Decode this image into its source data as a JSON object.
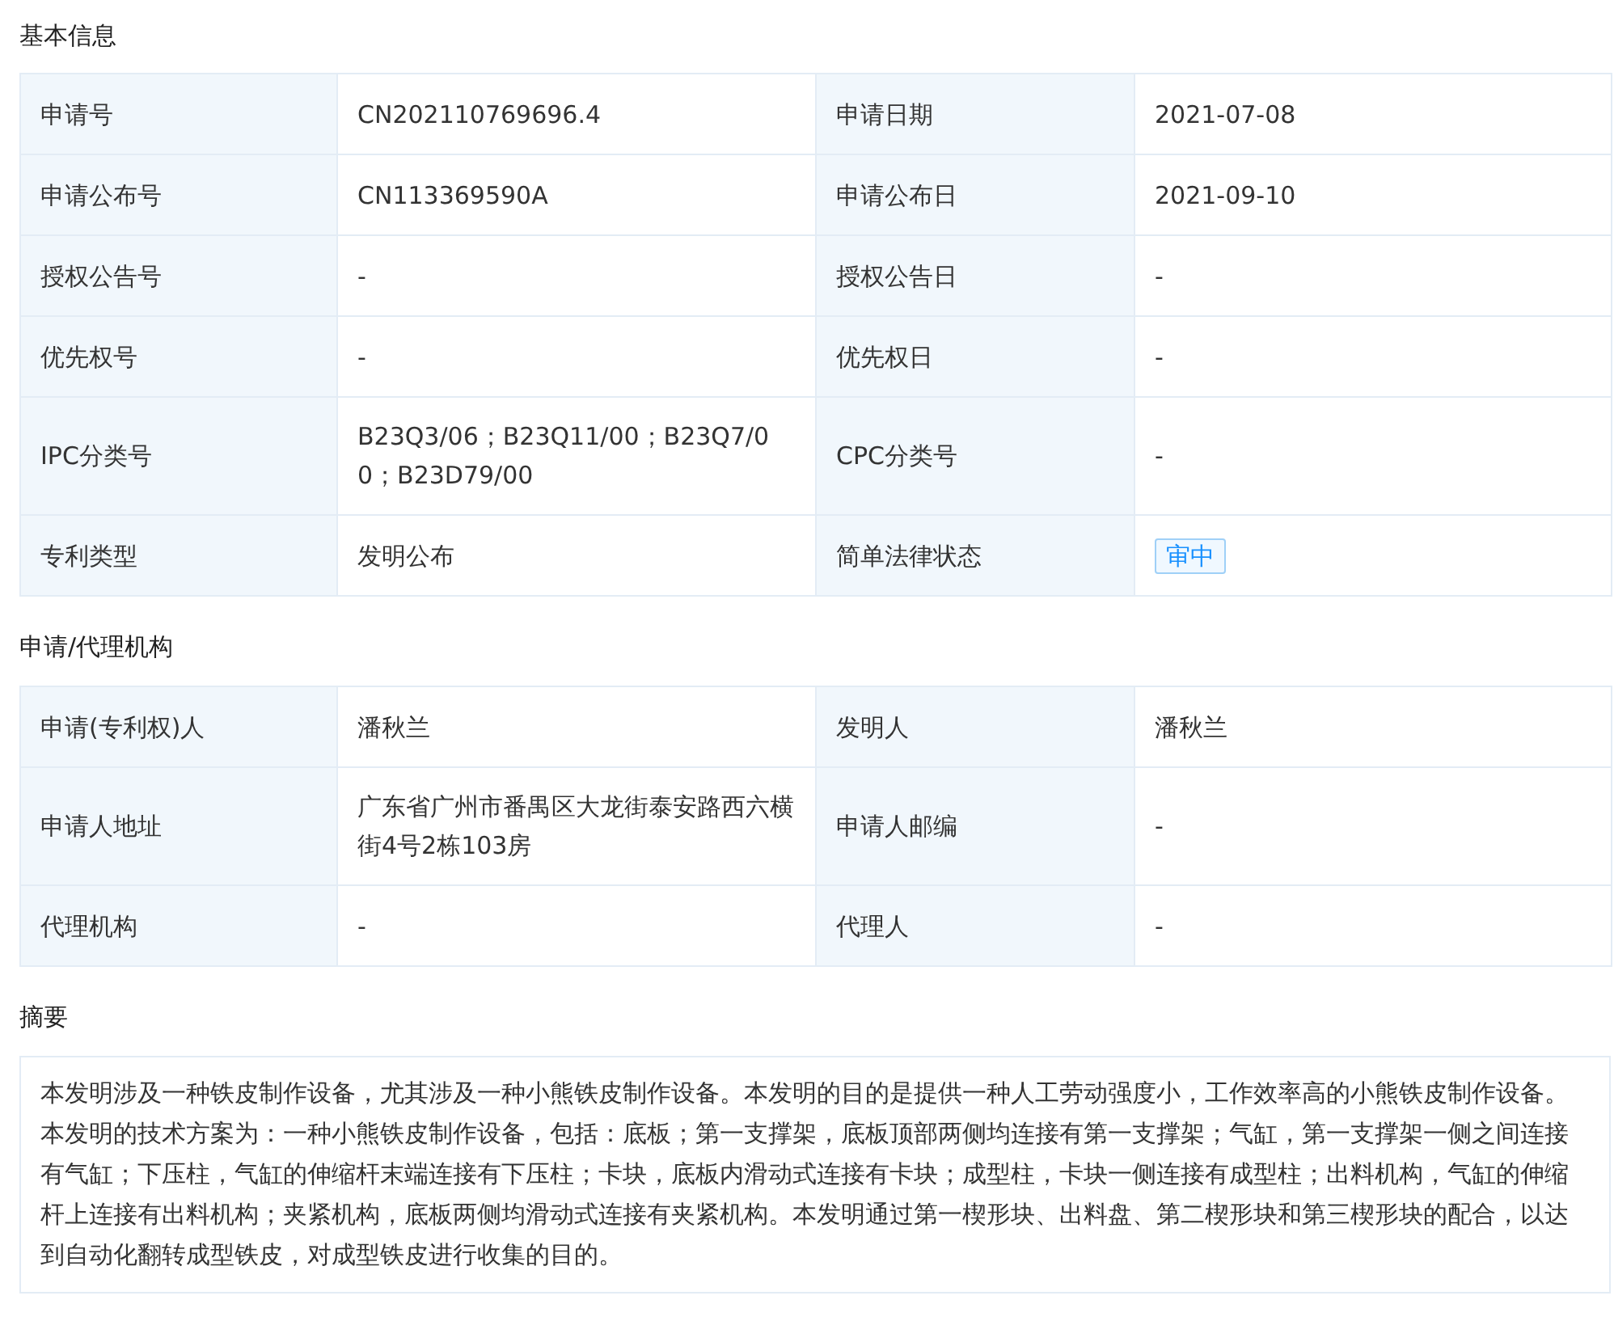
{
  "sections": [
    {
      "title": "基本信息",
      "rows": [
        [
          {
            "label": "申请号",
            "value": "CN202110769696.4",
            "kind": "text"
          },
          {
            "label": "申请日期",
            "value": "2021-07-08",
            "kind": "text"
          }
        ],
        [
          {
            "label": "申请公布号",
            "value": "CN113369590A",
            "kind": "text"
          },
          {
            "label": "申请公布日",
            "value": "2021-09-10",
            "kind": "text"
          }
        ],
        [
          {
            "label": "授权公告号",
            "value": "-",
            "kind": "text"
          },
          {
            "label": "授权公告日",
            "value": "-",
            "kind": "text"
          }
        ],
        [
          {
            "label": "优先权号",
            "value": "-",
            "kind": "text"
          },
          {
            "label": "优先权日",
            "value": "-",
            "kind": "text"
          }
        ],
        [
          {
            "label": "IPC分类号",
            "value": "B23Q3/06；B23Q11/00；B23Q7/00；B23D79/00",
            "kind": "text"
          },
          {
            "label": "CPC分类号",
            "value": "-",
            "kind": "text"
          }
        ],
        [
          {
            "label": "专利类型",
            "value": "发明公布",
            "kind": "text"
          },
          {
            "label": "简单法律状态",
            "value": "审中",
            "kind": "tag"
          }
        ]
      ]
    },
    {
      "title": "申请/代理机构",
      "rows": [
        [
          {
            "label": "申请(专利权)人",
            "value": "潘秋兰",
            "kind": "text"
          },
          {
            "label": "发明人",
            "value": "潘秋兰",
            "kind": "text"
          }
        ],
        [
          {
            "label": "申请人地址",
            "value": "广东省广州市番禺区大龙街泰安路西六横街4号2栋103房",
            "kind": "text"
          },
          {
            "label": "申请人邮编",
            "value": "-",
            "kind": "text"
          }
        ],
        [
          {
            "label": "代理机构",
            "value": "-",
            "kind": "text"
          },
          {
            "label": "代理人",
            "value": "-",
            "kind": "text"
          }
        ]
      ]
    }
  ],
  "abstract": {
    "title": "摘要",
    "text": "本发明涉及一种铁皮制作设备，尤其涉及一种小熊铁皮制作设备。本发明的目的是提供一种人工劳动强度小，工作效率高的小熊铁皮制作设备。本发明的技术方案为：一种小熊铁皮制作设备，包括：底板；第一支撑架，底板顶部两侧均连接有第一支撑架；气缸，第一支撑架一侧之间连接有气缸；下压柱，气缸的伸缩杆末端连接有下压柱；卡块，底板内滑动式连接有卡块；成型柱，卡块一侧连接有成型柱；出料机构，气缸的伸缩杆上连接有出料机构；夹紧机构，底板两侧均滑动式连接有夹紧机构。本发明通过第一楔形块、出料盘、第二楔形块和第三楔形块的配合，以达到自动化翻转成型铁皮，对成型铁皮进行收集的目的。"
  }
}
